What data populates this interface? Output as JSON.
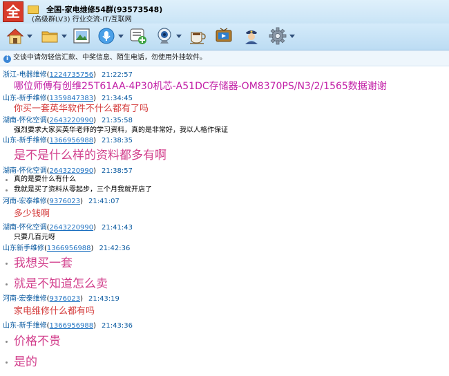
{
  "header": {
    "avatar_char": "全",
    "title": "全国-家电维修54群(93573548)",
    "subtitle": "(高级群LV3) 行业交流-IT/互联网"
  },
  "toolbar": {
    "items": [
      {
        "icon": "home-icon",
        "has_menu": true
      },
      {
        "icon": "folder-icon",
        "has_menu": true
      },
      {
        "icon": "photo-icon",
        "has_menu": false
      },
      {
        "icon": "microphone-icon",
        "has_menu": true
      },
      {
        "icon": "add-message-icon",
        "has_menu": false
      },
      {
        "icon": "webcam-icon",
        "has_menu": true
      },
      {
        "icon": "coffee-icon",
        "has_menu": false
      },
      {
        "icon": "tv-icon",
        "has_menu": false
      },
      {
        "icon": "police-icon",
        "has_menu": false
      },
      {
        "icon": "gear-icon",
        "has_menu": true
      }
    ]
  },
  "notice": {
    "text": "交谈中请勿轻信汇款、中奖信息、陌生电话，勿使用外挂软件。"
  },
  "messages": [
    {
      "name": "浙江-电器维修",
      "qq": "1224735756",
      "time": "21:22:57",
      "lines": [
        {
          "text": "哪位师傅有创维25T61AA-4P30机芯-A51DC存储器-OM8370PS/N3/2/1565数据谢谢",
          "style": "purple"
        }
      ]
    },
    {
      "name": "山东-新手维修",
      "qq": "1359847383",
      "time": "21:34:45",
      "lines": [
        {
          "text": "你买一套英华软件不什么都有了吗",
          "style": "red"
        }
      ]
    },
    {
      "name": "湖南-怀化空调",
      "qq": "2643220990",
      "time": "21:35:58",
      "lines": [
        {
          "text": "强烈要求大家买英华老师的学习资料，真的是非常好，我以人格作保证",
          "style": "small"
        }
      ]
    },
    {
      "name": "山东-新手维修",
      "qq": "1366956988",
      "time": "21:38:35",
      "lines": [
        {
          "text": "是不是什么样的资料都多有啊",
          "style": "big"
        }
      ]
    },
    {
      "name": "湖南-怀化空调",
      "qq": "2643220990",
      "time": "21:38:57",
      "lines": [
        {
          "text": "真的是要什么有什么",
          "style": "small"
        },
        {
          "text": "我就是买了资料从零起步，三个月我就开店了",
          "style": "small"
        }
      ]
    },
    {
      "name": "河南-宏泰维修",
      "qq": "9376023",
      "time": "21:41:07",
      "lines": [
        {
          "text": "多少钱啊",
          "style": "red"
        }
      ]
    },
    {
      "name": "湖南-怀化空调",
      "qq": "2643220990",
      "time": "21:41:43",
      "lines": [
        {
          "text": "只要几百元呀",
          "style": "small"
        }
      ]
    },
    {
      "name": "山东新手维修",
      "qq": "1366956988",
      "time": "21:42:36",
      "lines": [
        {
          "text": "我想买一套",
          "style": "big"
        },
        {
          "text": "就是不知道怎么卖",
          "style": "big"
        }
      ]
    },
    {
      "name": "河南-宏泰维修",
      "qq": "9376023",
      "time": "21:43:19",
      "lines": [
        {
          "text": "家电维修什么都有吗",
          "style": "red"
        }
      ]
    },
    {
      "name": "山东-新手维修",
      "qq": "1366956988",
      "time": "21:43:36",
      "lines": [
        {
          "text": "价格不贵",
          "style": "big"
        },
        {
          "text": "是的",
          "style": "big"
        }
      ]
    }
  ]
}
